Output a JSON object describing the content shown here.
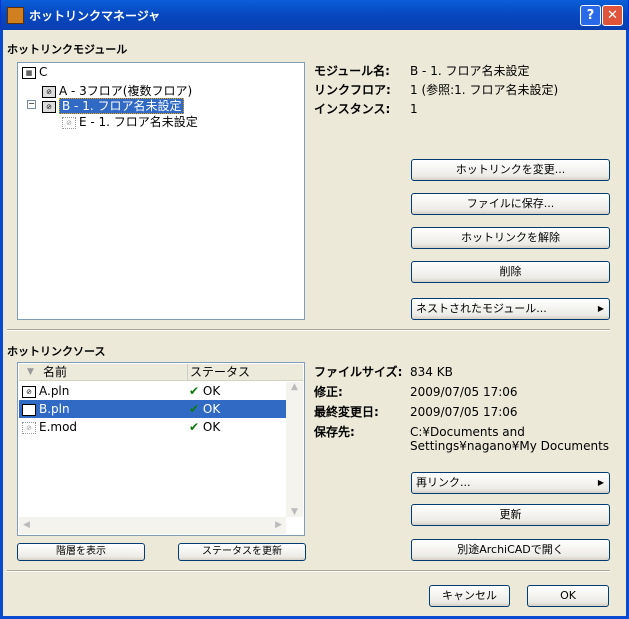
{
  "window": {
    "title": "ホットリンクマネージャ",
    "help": "?",
    "close": "✕"
  },
  "modules": {
    "heading": "ホットリンクモジュール",
    "tree": [
      {
        "label": "C"
      },
      {
        "label": "A - 3フロア(複数フロア)"
      },
      {
        "label": "B - 1. フロア名未設定"
      },
      {
        "label": "E - 1. フロア名未設定"
      }
    ],
    "info": [
      {
        "label": "モジュール名:",
        "value": "B - 1. フロア名未設定"
      },
      {
        "label": "リンクフロア:",
        "value": "1 (参照:1. フロア名未設定)"
      },
      {
        "label": "インスタンス:",
        "value": "1"
      }
    ],
    "buttons": {
      "change": "ホットリンクを変更...",
      "save": "ファイルに保存...",
      "break": "ホットリンクを解除",
      "delete": "削除",
      "nested": "ネストされたモジュール..."
    }
  },
  "sources": {
    "heading": "ホットリンクソース",
    "columns": [
      "名前",
      "ステータス"
    ],
    "rows": [
      {
        "name": "A.pln",
        "status": "OK"
      },
      {
        "name": "B.pln",
        "status": "OK"
      },
      {
        "name": "E.mod",
        "status": "OK"
      }
    ],
    "buttons": {
      "hierarchy": "階層を表示",
      "refresh_status": "ステータスを更新",
      "relink": "再リンク...",
      "update": "更新",
      "open": "別途ArchiCADで開く"
    },
    "info": [
      {
        "label": "ファイルサイズ:",
        "value": "834 KB"
      },
      {
        "label": "修正:",
        "value": "2009/07/05 17:06"
      },
      {
        "label": "最終変更日:",
        "value": "2009/07/05 17:06"
      },
      {
        "label": "保存先:",
        "value": "C:¥Documents and",
        "value2": "Settings¥nagano¥My Documents"
      }
    ]
  },
  "footer": {
    "cancel": "キャンセル",
    "ok": "OK"
  }
}
